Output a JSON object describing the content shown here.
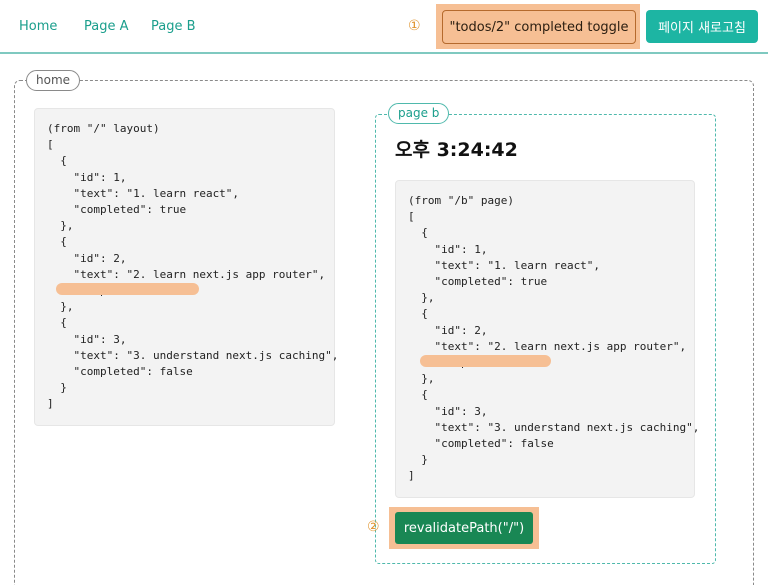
{
  "nav": {
    "home_label": "Home",
    "page_a_label": "Page A",
    "page_b_label": "Page B"
  },
  "markers": {
    "one": "①",
    "two": "②"
  },
  "toolbar": {
    "toggle_label": "\"todos/2\" completed toggle",
    "refresh_label": "페이지 새로고침"
  },
  "home": {
    "tag": "home",
    "code": "(from \"/\" layout)\n[\n  {\n    \"id\": 1,\n    \"text\": \"1. learn react\",\n    \"completed\": true\n  },\n  {\n    \"id\": 2,\n    \"text\": \"2. learn next.js app router\",\n    \"completed\": false\n  },\n  {\n    \"id\": 3,\n    \"text\": \"3. understand next.js caching\",\n    \"completed\": false\n  }\n]"
  },
  "page_b": {
    "tag": "page b",
    "time": "오후 3:24:42",
    "code": "(from \"/b\" page)\n[\n  {\n    \"id\": 1,\n    \"text\": \"1. learn react\",\n    \"completed\": true\n  },\n  {\n    \"id\": 2,\n    \"text\": \"2. learn next.js app router\",\n    \"completed\": true\n  },\n  {\n    \"id\": 3,\n    \"text\": \"3. understand next.js caching\",\n    \"completed\": false\n  }\n]",
    "revalidate_label": "revalidatePath(\"/\")"
  },
  "colors": {
    "accent": "#1db5a3",
    "highlight": "#f6bf94",
    "revalidate_button": "#198754"
  }
}
